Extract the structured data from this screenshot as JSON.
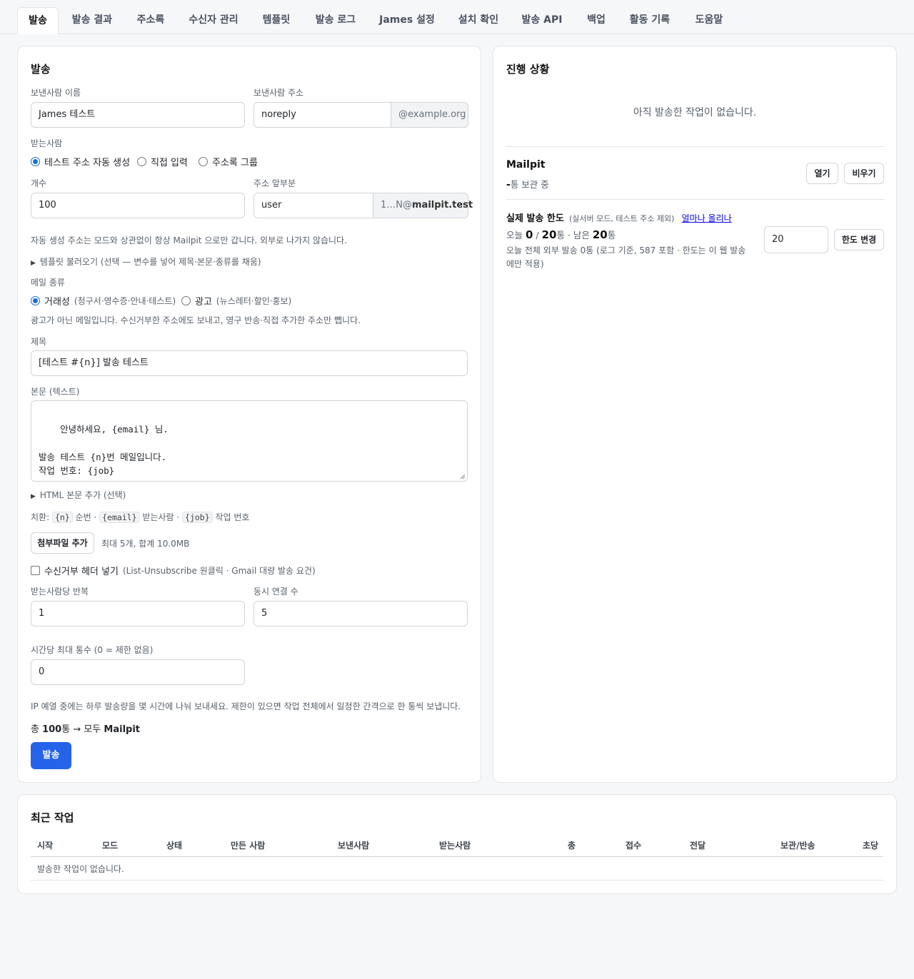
{
  "tabs": [
    "발송",
    "발송 결과",
    "주소록",
    "수신자 관리",
    "템플릿",
    "발송 로그",
    "James 설정",
    "설치 확인",
    "발송 API",
    "백업",
    "활동 기록",
    "도움말"
  ],
  "send": {
    "title": "발송",
    "sender_name_label": "보낸사람 이름",
    "sender_name_value": "James 테스트",
    "sender_addr_label": "보낸사람 주소",
    "sender_addr_value": "noreply",
    "sender_domain": "@example.org",
    "recipient_label": "받는사람",
    "recipient_options": [
      "테스트 주소 자동 생성",
      "직접 입력",
      "주소록 그룹"
    ],
    "recipient_selected": "테스트 주소 자동 생성",
    "count_label": "개수",
    "count_value": "100",
    "prefix_label": "주소 앞부분",
    "prefix_value": "user",
    "prefix_suffix_a": "1…N@",
    "prefix_suffix_b": "mailpit.test",
    "auto_note": "자동 생성 주소는 모드와 상관없이 항상 Mailpit 으로만 갑니다. 외부로 나가지 않습니다.",
    "template_summary": "템플릿 불러오기 (선택 — 변수를 넣어 제목·본문·종류를 채움)",
    "mail_type_label": "메일 종류",
    "mail_type_tx": "거래성",
    "mail_type_tx_hint": "(청구서·영수증·안내·테스트)",
    "mail_type_ad": "광고",
    "mail_type_ad_hint": "(뉴스레터·할인·홍보)",
    "mail_type_note": "광고가 아닌 메일입니다. 수신거부한 주소에도 보내고, 영구 반송·직접 추가한 주소만 뺍니다.",
    "subject_label": "제목",
    "subject_value": "[테스트 #{n}] 발송 테스트",
    "body_label": "본문 (텍스트)",
    "body_value": "안녕하세요, {email} 님.\n\n발송 테스트 {n}번 메일입니다.\n작업 번호: {job}",
    "html_summary": "HTML 본문 추가 (선택)",
    "subs_prefix": "치환:",
    "subs_n": "{n}",
    "subs_n_desc": "순번 ·",
    "subs_email": "{email}",
    "subs_email_desc": "받는사람 ·",
    "subs_job": "{job}",
    "subs_job_desc": "작업 번호",
    "attach_button": "첨부파일 추가",
    "attach_note": "최대 5개, 합계 10.0MB",
    "unsub_label": "수신거부 헤더 넣기",
    "unsub_hint": "(List-Unsubscribe 원클릭 · Gmail 대량 발송 요건)",
    "repeat_label": "받는사람당 반복",
    "repeat_value": "1",
    "conn_label": "동시 연결 수",
    "conn_value": "5",
    "rate_label": "시간당 최대 통수 (0 = 제한 없음)",
    "rate_value": "0",
    "rate_note": "IP 예열 중에는 하루 발송량을 몇 시간에 나눠 보내세요. 제한이 있으면 작업 전체에서 일정한 간격으로 한 통씩 보냅니다.",
    "total_prefix": "총 ",
    "total_count": "100",
    "total_mid": "통 → 모두 ",
    "total_target": "Mailpit",
    "send_button": "발송"
  },
  "progress": {
    "title": "진행 상황",
    "empty": "아직 발송한 작업이 없습니다.",
    "mailpit_title": "Mailpit",
    "mailpit_count": "-",
    "mailpit_count_suffix": "통 보관 중",
    "open_button": "열기",
    "clear_button": "비우기",
    "limit_title": "실제 발송 한도",
    "limit_hint": "(실서버 모드, 테스트 주소 제외)",
    "limit_link": "얼마나 올리나",
    "today_prefix": "오늘 ",
    "today_sent": "0",
    "today_sep": " / ",
    "today_limit": "20",
    "today_mid": "통 · 남은 ",
    "today_remaining": "20",
    "today_suffix": "통",
    "limit_note": "오늘 전체 외부 발송 0통 (로그 기준, 587 포함 · 한도는 이 웹 발송에만 적용)",
    "limit_input": "20",
    "limit_button": "한도 변경"
  },
  "recent": {
    "title": "최근 작업",
    "columns": [
      "시작",
      "모드",
      "상태",
      "만든 사람",
      "보낸사람",
      "받는사람",
      "총",
      "접수",
      "전달",
      "보관/반송",
      "초당"
    ],
    "empty": "발송한 작업이 없습니다."
  },
  "colors": {
    "primary": "#2563eb",
    "radio_accent": "#1a6dd8",
    "link": "#0000ee"
  }
}
